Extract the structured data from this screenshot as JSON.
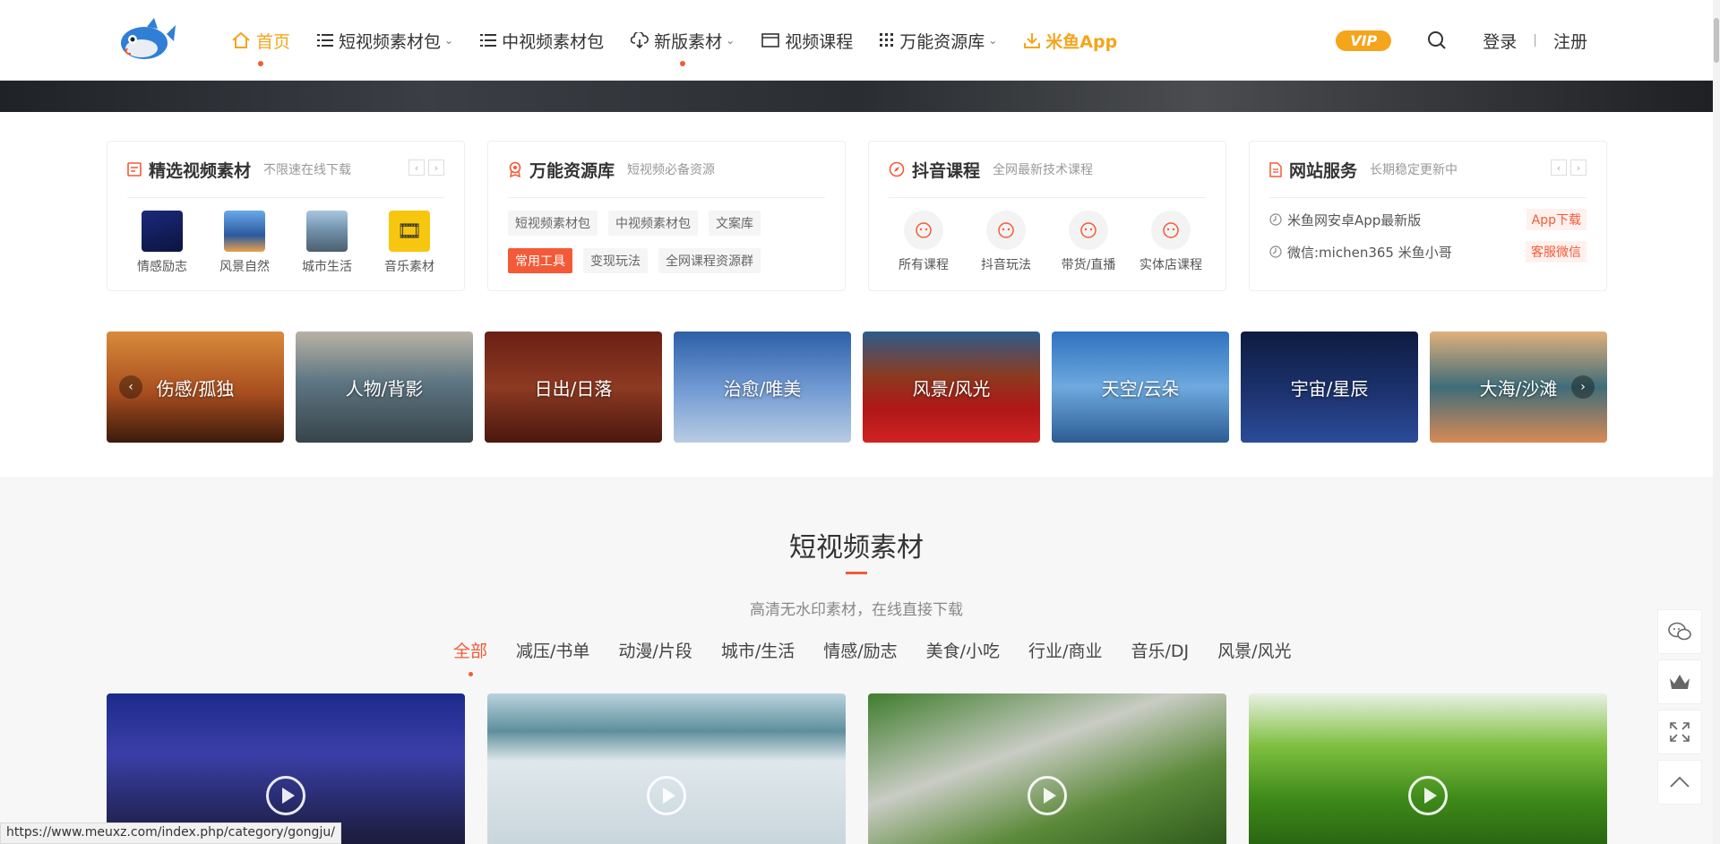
{
  "header": {
    "nav": [
      {
        "label": "首页",
        "icon": "home-icon",
        "active": true,
        "dot": true
      },
      {
        "label": "短视频素材包",
        "icon": "list-icon",
        "dropdown": true
      },
      {
        "label": "中视频素材包",
        "icon": "list-icon"
      },
      {
        "label": "新版素材",
        "icon": "cloud-download-icon",
        "dropdown": true,
        "dot": true
      },
      {
        "label": "视频课程",
        "icon": "calendar-icon"
      },
      {
        "label": "万能资源库",
        "icon": "grid-icon",
        "dropdown": true
      },
      {
        "label": "米鱼App",
        "icon": "download-icon"
      }
    ],
    "vip_label": "VIP",
    "login": "登录",
    "separator": "|",
    "register": "注册"
  },
  "cards": {
    "featured": {
      "title": "精选视频素材",
      "subtitle": "不限速在线下载",
      "items": [
        "情感励志",
        "风景自然",
        "城市生活",
        "音乐素材"
      ]
    },
    "resources": {
      "title": "万能资源库",
      "subtitle": "短视频必备资源",
      "tags": [
        "短视频素材包",
        "中视频素材包",
        "文案库",
        "常用工具",
        "变现玩法",
        "全网课程资源群"
      ]
    },
    "douyin": {
      "title": "抖音课程",
      "subtitle": "全网最新技术课程",
      "items": [
        "所有课程",
        "抖音玩法",
        "带货/直播",
        "实体店课程"
      ]
    },
    "service": {
      "title": "网站服务",
      "subtitle": "长期稳定更新中",
      "rows": [
        {
          "text": "米鱼网安卓App最新版",
          "button": "App下载"
        },
        {
          "text": "微信:michen365 米鱼小哥",
          "button": "客服微信"
        }
      ]
    }
  },
  "categories": [
    "伤感/孤独",
    "人物/背影",
    "日出/日落",
    "治愈/唯美",
    "风景/风光",
    "天空/云朵",
    "宇宙/星辰",
    "大海/沙滩"
  ],
  "section": {
    "title": "短视频素材",
    "subtitle": "高清无水印素材，在线直接下载",
    "filters": [
      "全部",
      "减压/书单",
      "动漫/片段",
      "城市/生活",
      "情感/励志",
      "美食/小吃",
      "行业/商业",
      "音乐/DJ",
      "风景/风光"
    ]
  },
  "status_url": "https://www.meuxz.com/index.php/category/gongju/",
  "colors": {
    "accent": "#f4a51c",
    "red": "#f45a37"
  }
}
